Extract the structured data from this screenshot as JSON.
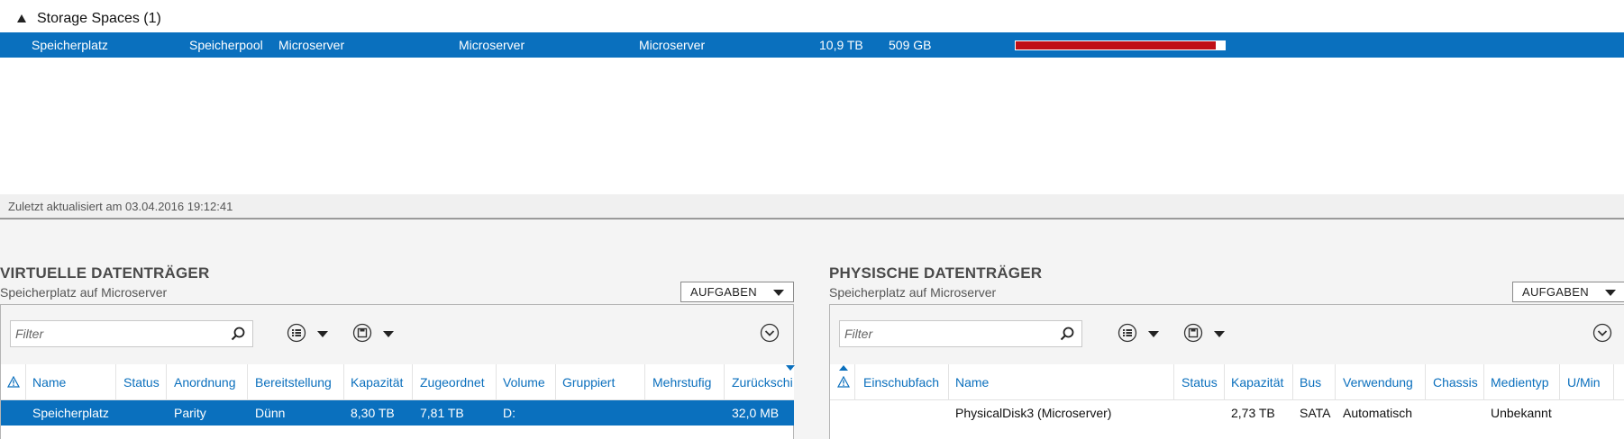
{
  "pool_group": {
    "title": "Storage Spaces (1)"
  },
  "pool_row": {
    "name": "Speicherplatz",
    "type": "Speicherpool",
    "managed_by": "Microserver",
    "available_to": "Microserver",
    "read_write_server": "Microserver",
    "capacity": "10,9 TB",
    "free_space": "509 GB",
    "usage_fraction": 0.955,
    "usage_color": "#c00f16"
  },
  "status": {
    "last_updated": "Zuletzt aktualisiert am 03.04.2016 19:12:41"
  },
  "virtual_disks": {
    "title": "VIRTUELLE DATENTRÄGER",
    "subtitle": "Speicherplatz auf Microserver",
    "tasks_label": "AUFGABEN",
    "filter_placeholder": "Filter",
    "columns": [
      "Name",
      "Status",
      "Anordnung",
      "Bereitstellung",
      "Kapazität",
      "Zugeordnet",
      "Volume",
      "Gruppiert",
      "Mehrstufig",
      "Zurückschi"
    ],
    "rows": [
      {
        "name": "Speicherplatz",
        "status": "",
        "layout": "Parity",
        "provisioning": "Dünn",
        "capacity": "8,30 TB",
        "allocated": "7,81 TB",
        "volume": "D:",
        "clustered": "",
        "tiered": "",
        "writeback": "32,0 MB"
      }
    ]
  },
  "physical_disks": {
    "title": "PHYSISCHE DATENTRÄGER",
    "subtitle": "Speicherplatz auf Microserver",
    "tasks_label": "AUFGABEN",
    "filter_placeholder": "Filter",
    "columns": [
      "Einschubfach",
      "Name",
      "Status",
      "Kapazität",
      "Bus",
      "Verwendung",
      "Chassis",
      "Medientyp",
      "U/Min"
    ],
    "rows": [
      {
        "slot": "",
        "name": "PhysicalDisk3 (Microserver)",
        "status": "",
        "capacity": "2,73 TB",
        "bus": "SATA",
        "usage": "Automatisch",
        "chassis": "",
        "media_type": "Unbekannt",
        "rpm": ""
      }
    ]
  },
  "colors": {
    "selection": "#0a70be",
    "header_link": "#0a6fbd",
    "capacity_bar": "#c00f16"
  }
}
